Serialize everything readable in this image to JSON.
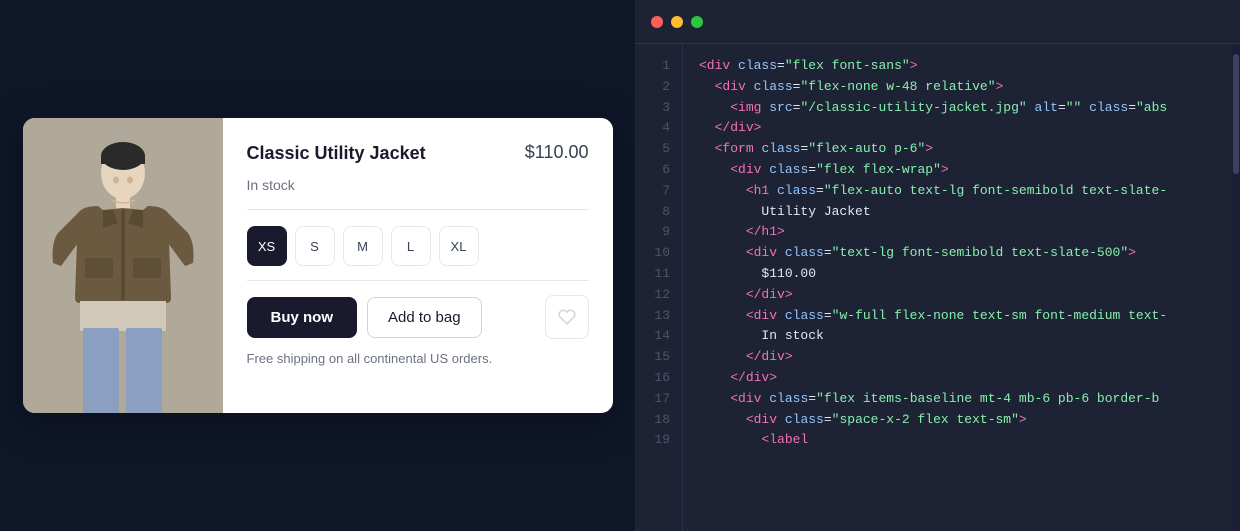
{
  "product": {
    "title": "Classic Utility Jacket",
    "price": "$110.00",
    "status": "In stock",
    "shipping": "Free shipping on all continental US orders.",
    "sizes": [
      "XS",
      "S",
      "M",
      "L",
      "XL"
    ],
    "selected_size": "XS",
    "buy_label": "Buy now",
    "add_to_bag_label": "Add to bag"
  },
  "editor": {
    "traffic_lights": [
      "red",
      "yellow",
      "green"
    ],
    "lines": [
      {
        "num": "1",
        "code": "<div class=\"flex font-sans\">"
      },
      {
        "num": "2",
        "code": "  <div class=\"flex-none w-48 relative\">"
      },
      {
        "num": "3",
        "code": "    <img src=\"/classic-utility-jacket.jpg\" alt=\"\" class=\"abs"
      },
      {
        "num": "4",
        "code": "  </div>"
      },
      {
        "num": "5",
        "code": "  <form class=\"flex-auto p-6\">"
      },
      {
        "num": "6",
        "code": "    <div class=\"flex flex-wrap\">"
      },
      {
        "num": "7",
        "code": "      <h1 class=\"flex-auto text-lg font-semibold text-slate-"
      },
      {
        "num": "8",
        "code": "        Utility Jacket"
      },
      {
        "num": "9",
        "code": "      </h1>"
      },
      {
        "num": "10",
        "code": "      <div class=\"text-lg font-semibold text-slate-500\">"
      },
      {
        "num": "11",
        "code": "        $110.00"
      },
      {
        "num": "12",
        "code": "      </div>"
      },
      {
        "num": "13",
        "code": "      <div class=\"w-full flex-none text-sm font-medium text-"
      },
      {
        "num": "14",
        "code": "        In stock"
      },
      {
        "num": "15",
        "code": "      </div>"
      },
      {
        "num": "16",
        "code": "    </div>"
      },
      {
        "num": "17",
        "code": "    <div class=\"flex items-baseline mt-4 mb-6 pb-6 border-b"
      },
      {
        "num": "18",
        "code": "      <div class=\"space-x-2 flex text-sm\">"
      },
      {
        "num": "19",
        "code": "        <label"
      }
    ]
  }
}
